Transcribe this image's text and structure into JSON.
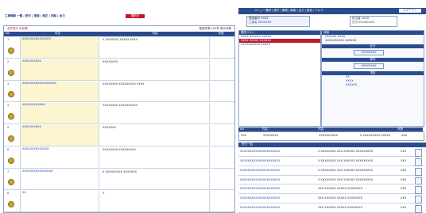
{
  "top_bar": {
    "title": "工事情報 | 受発注システム",
    "right_label": "ログアウト",
    "menu_text": "メニュー選択 | 受付 | 管理 | 検索 | 出力 | 設定 | ヘルプ"
  },
  "header": {
    "left_title": "工事情報 一覧 | 受付 | 登録 | 修正 | 削除 | 出力",
    "tab_red": "選択中",
    "box1": "登録番号 XXXX",
    "box1_sub": "工事名 XXXXXXX",
    "box2": "担当者 XXXX",
    "box2_sub": "日付 2024/01/01"
  },
  "left_panel": {
    "filter_label": "全件表示  未処理",
    "right_info": "登録件数 120件  表示件数",
    "columns": [
      "No",
      "件名",
      "内容",
      "状態"
    ],
    "rows": [
      {
        "no": "1",
        "title": "XXXXXXXXXXXXXXX",
        "desc": "X XXXXXXX XXXXX XXXX",
        "status": ""
      },
      {
        "no": "2",
        "title": "XXXXXXXXXX",
        "desc": "XXXXXXXX",
        "status": ""
      },
      {
        "no": "3",
        "title": "XXXXXXXXXXXXXXXXXX",
        "desc": "XXXXXXXX XXXXXXXXX XXXX",
        "status": ""
      },
      {
        "no": "4",
        "title": "XXXXXXXXXXXX",
        "desc": "XXXXXXXX XXXXXXXXXX",
        "status": ""
      },
      {
        "no": "5",
        "title": "XXXXXXXXXX",
        "desc": "XXXXXXX",
        "status": ""
      },
      {
        "no": "6",
        "title": "XXXXXXXXXXXXXX",
        "desc": "XXXXXXXX XXXXXXXXX",
        "status": ""
      },
      {
        "no": "7",
        "title": "XXXXXXXXXXXXXXXX",
        "desc": "X XXXXXXXXX XXXXXXX",
        "status": ""
      },
      {
        "no": "8",
        "title": "XX",
        "desc": "X",
        "status": ""
      }
    ]
  },
  "right_panel": {
    "list_header": "選択リスト",
    "list_items": [
      "XXXX XXXXXX XXXXX",
      "XXXX XXXXX XXXXXX",
      "XXXXXXXXXX XXXXX"
    ],
    "detail_header": "詳細",
    "detail_title": "XXXXXX XXXX",
    "detail_sub": "XXXXXXXXXX XXXXXX",
    "section_labels": [
      "区分",
      "条件",
      "項目",
      "設定"
    ],
    "button_label": "XXXXXXXX",
    "small_rows": [
      "XX",
      "XXXX",
      "XXXXXX"
    ],
    "mid_header": [
      "No",
      "件名",
      "内容",
      "状態"
    ],
    "mid_row": {
      "no": "XXX",
      "name": "XXXXXXXX",
      "desc": "XXXXXXXXXX",
      "note": "X XXXXXXXXX XXXXX",
      "status": "XXX"
    },
    "bottom_header": "受付一覧",
    "bottom_rows": [
      {
        "name": "XXXXXXXXXXXXXXXXXXXXX",
        "desc": "X XXXXXXXX XXX XXXXXX XXXXXXXXX",
        "status": "XXX"
      },
      {
        "name": "XXXXXXXXXXXXXXXXXXXXX",
        "desc": "X XXXXXXXX XXX XXXXXX XXXXXXXXX",
        "status": "XXX"
      },
      {
        "name": "XXXXXXXXXXXXXXXXXXXXX",
        "desc": "X XXXXXXXX XXX XXXXXX XXXXXXXXX",
        "status": "XXX"
      },
      {
        "name": "XXXXXXXXXXXXXXXXXXXXX",
        "desc": "X XXXXXXXX XXX XXXXXX XXXXXXXXX",
        "status": "XXX"
      },
      {
        "name": "XXXXXXXXXXXXXXXXXXXXX",
        "desc": "XXX XXXXXX XXXXX XXXXXXXX",
        "status": "XXX"
      },
      {
        "name": "XXXXXXXXXXXXXXXXXXXXX",
        "desc": "XXX XXXXXX XXXXX XXXXXXXX",
        "status": "XXX"
      },
      {
        "name": "XXXXXXXXXXXXXXXXXXXXX",
        "desc": "XXX XXXXXX XXXXX XXXXXXXX",
        "status": "XXX"
      }
    ]
  },
  "colors": {
    "nav": "#2b4c8c",
    "accent_red": "#c2182b",
    "row_highlight": "#fbf6cf"
  }
}
